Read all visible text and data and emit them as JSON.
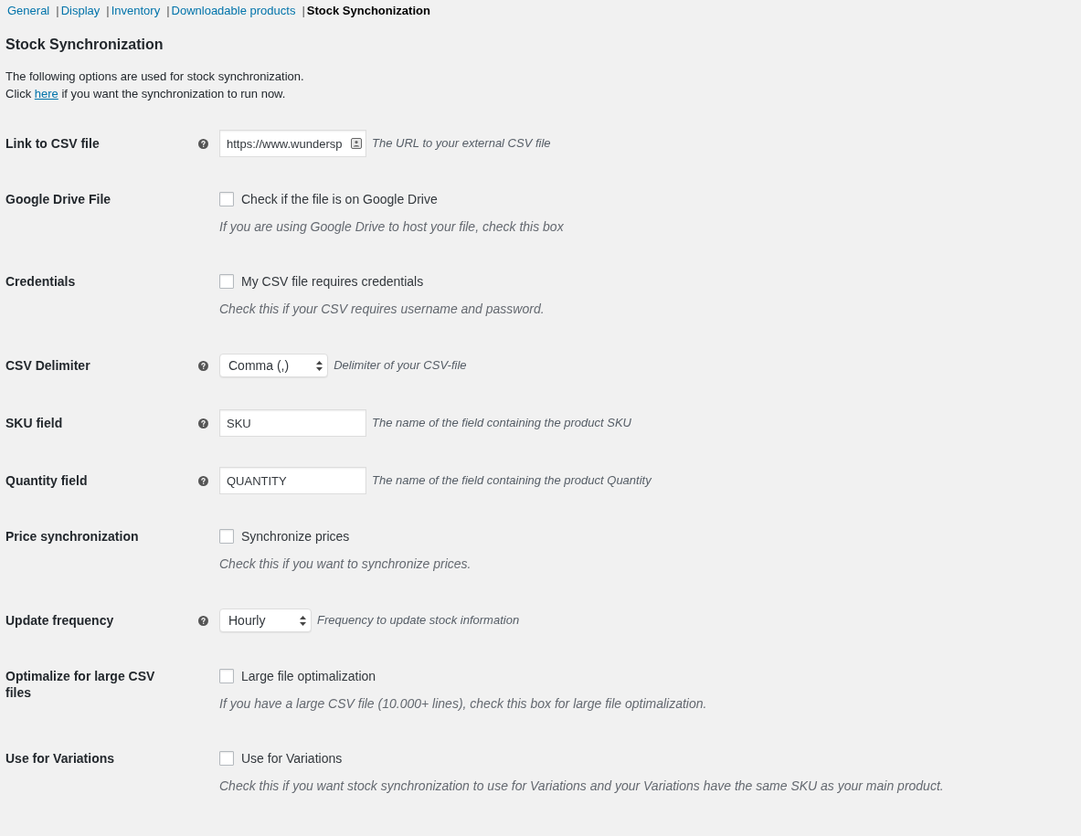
{
  "nav": {
    "separator": "|",
    "items": [
      {
        "label": "General",
        "selected": false
      },
      {
        "label": "Display",
        "selected": false
      },
      {
        "label": "Inventory",
        "selected": false
      },
      {
        "label": "Downloadable products",
        "selected": false
      },
      {
        "label": "Stock Synchonization",
        "selected": true
      }
    ]
  },
  "title": "Stock Synchronization",
  "intro": {
    "text": "The following options are used for stock synchronization.",
    "action": {
      "before": "Click",
      "link": "here",
      "after": "if you want the synchronization to run now."
    }
  },
  "settings": [
    {
      "kind": "text",
      "label": "Link to CSV file",
      "help": true,
      "value": "https://www.wundersp",
      "autofill": true,
      "description": "The URL to your external CSV file"
    },
    {
      "kind": "checkbox",
      "label": "Google Drive File",
      "help": false,
      "checked": false,
      "option": "Check if the file is on Google Drive",
      "description": "If you are using Google Drive to host your file, check this box"
    },
    {
      "kind": "checkbox",
      "label": "Credentials",
      "help": false,
      "checked": false,
      "option": "My CSV file requires credentials",
      "description": "Check this if your CSV requires username and password."
    },
    {
      "kind": "select",
      "label": "CSV Delimiter",
      "help": true,
      "value": "Comma (,)",
      "description": "Delimiter of your CSV-file"
    },
    {
      "kind": "text",
      "label": "SKU field",
      "help": true,
      "value": "SKU",
      "autofill": false,
      "description": "The name of the field containing the product SKU"
    },
    {
      "kind": "text",
      "label": "Quantity field",
      "help": true,
      "value": "QUANTITY",
      "autofill": false,
      "description": "The name of the field containing the product Quantity"
    },
    {
      "kind": "checkbox",
      "label": "Price synchronization",
      "help": false,
      "checked": false,
      "option": "Synchronize prices",
      "description": "Check this if you want to synchronize prices."
    },
    {
      "kind": "select",
      "label": "Update frequency",
      "help": true,
      "value": "Hourly",
      "description": "Frequency to update stock information"
    },
    {
      "kind": "checkbox",
      "label": "Optimalize for large CSV files",
      "help": false,
      "checked": false,
      "option": "Large file optimalization",
      "description": "If you have a large CSV file (10.000+ lines), check this box for large file optimalization."
    },
    {
      "kind": "checkbox",
      "label": "Use for Variations",
      "help": false,
      "checked": false,
      "option": "Use for Variations",
      "description": "Check this if you want stock synchronization to use for Variations and your Variations have the same SKU as your main product."
    }
  ]
}
